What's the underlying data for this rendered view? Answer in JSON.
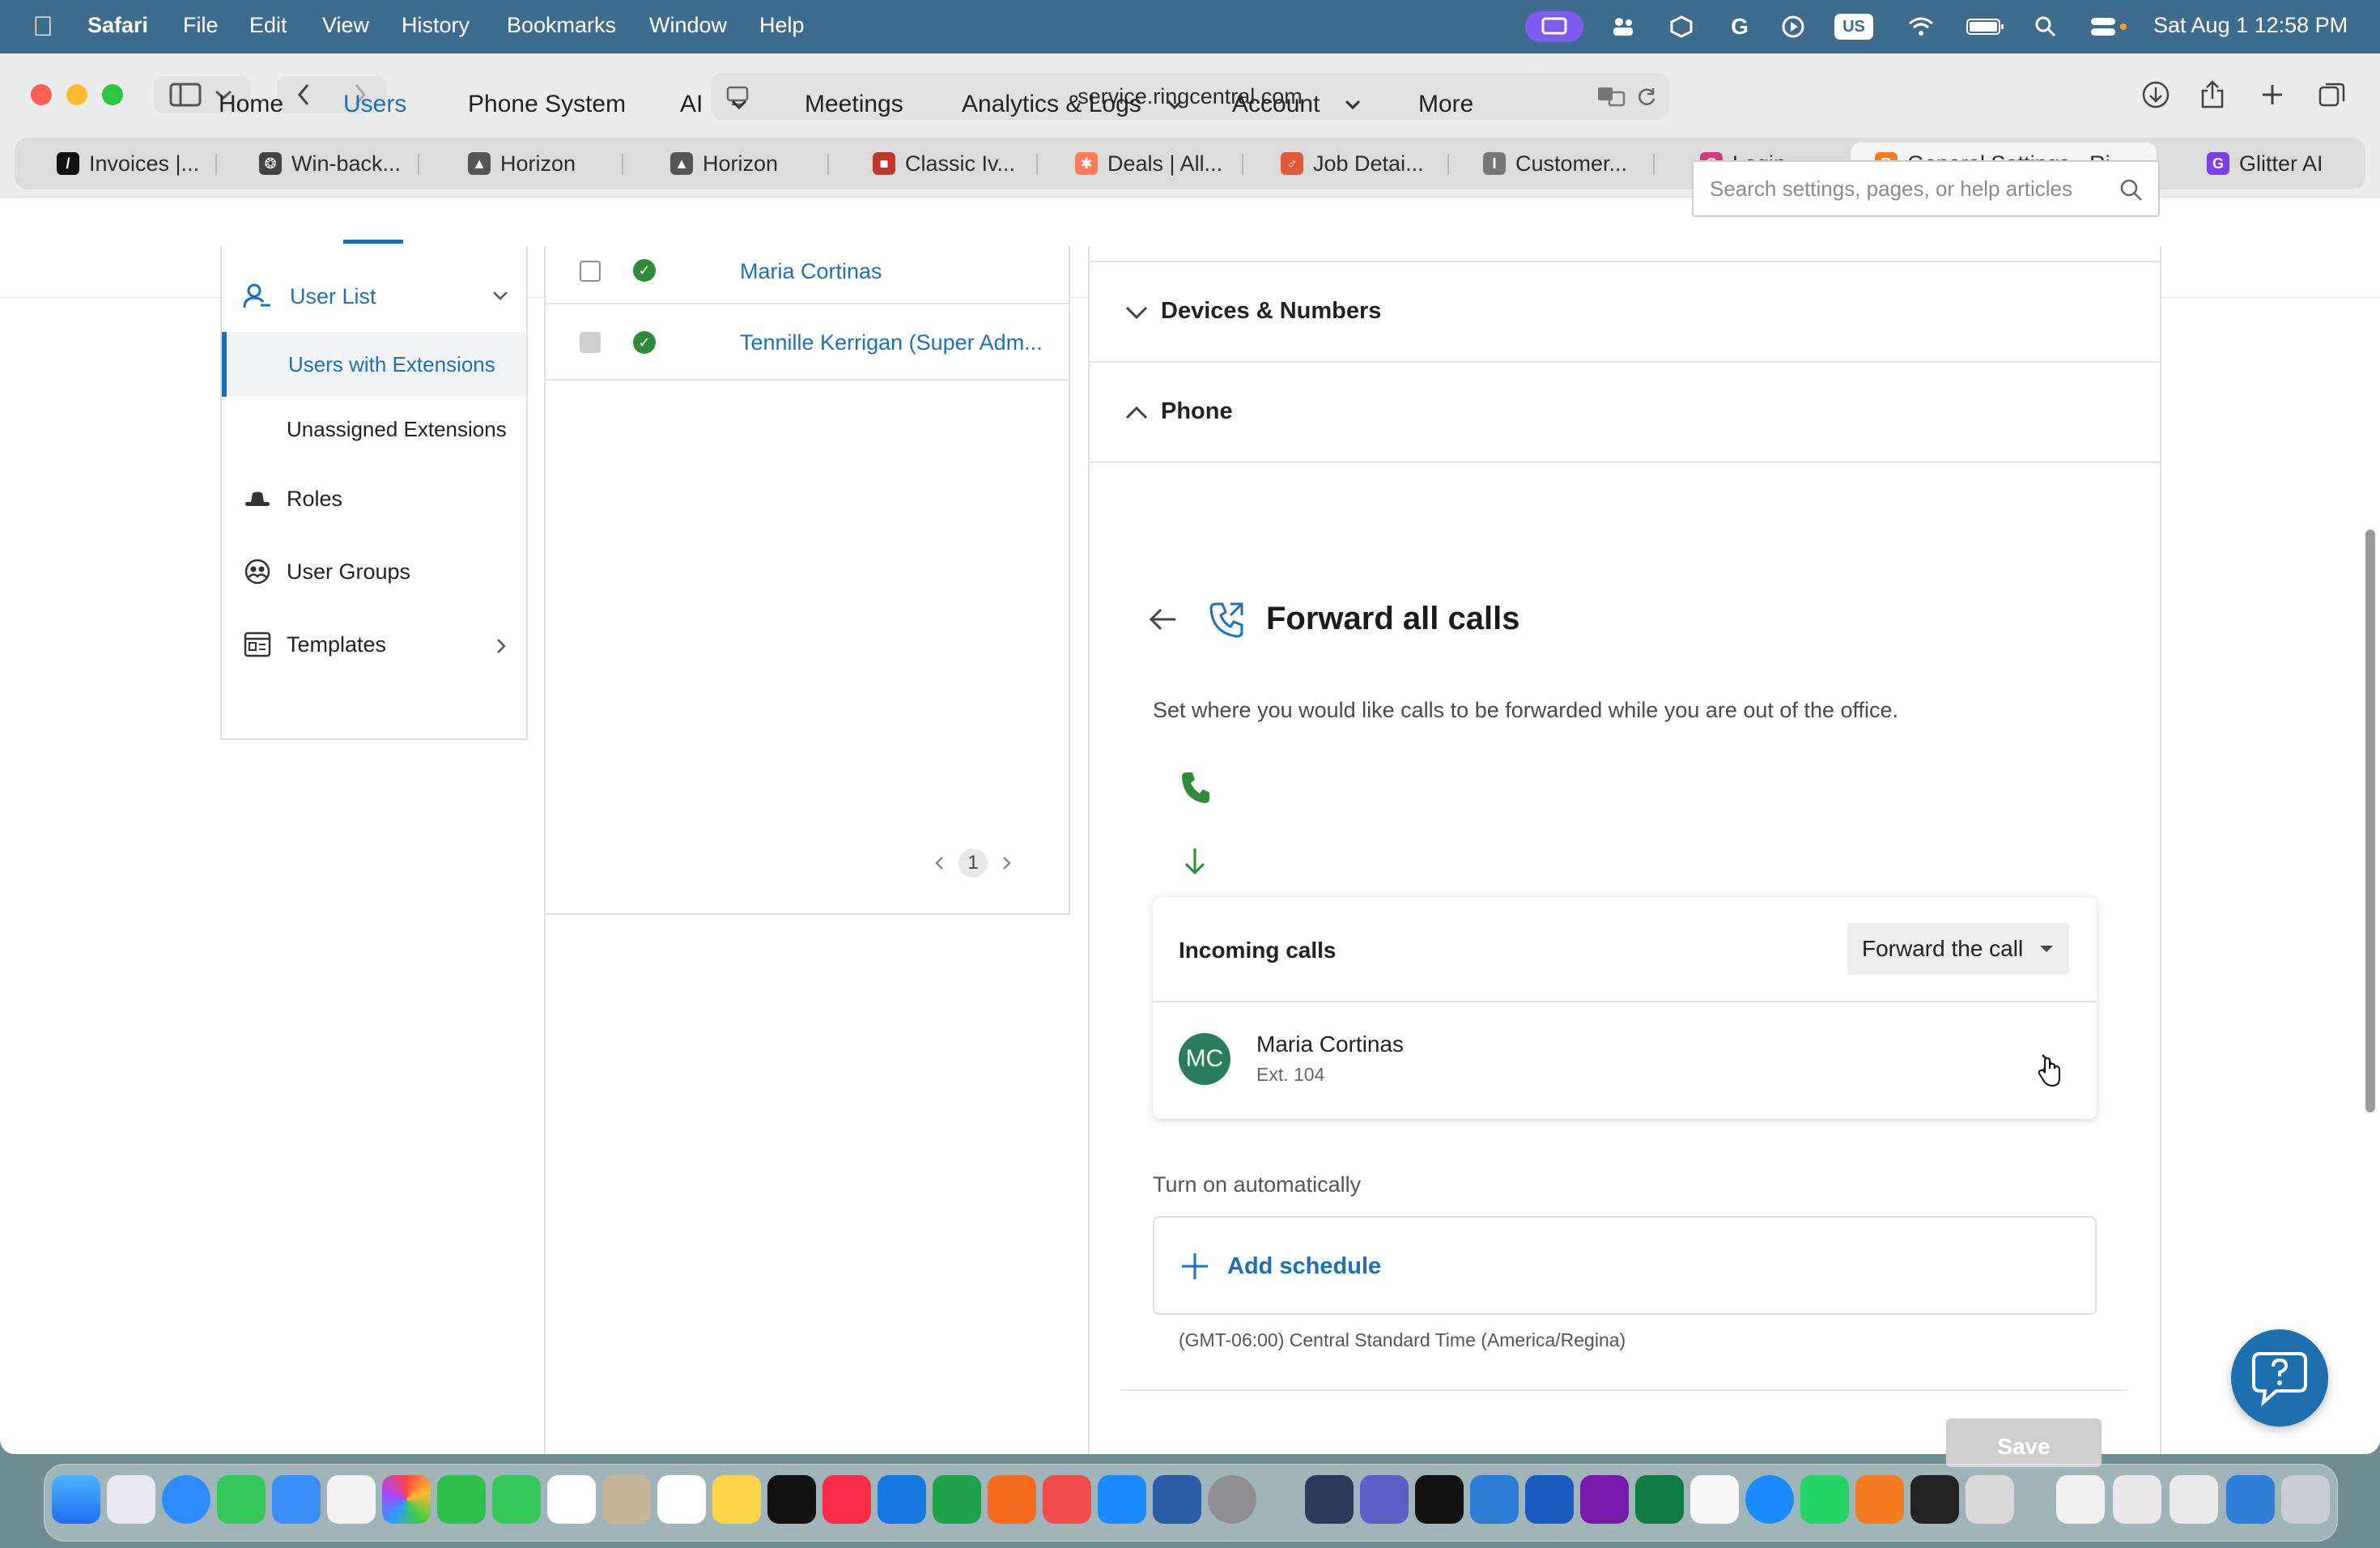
{
  "menubar": {
    "app": "Safari",
    "items": [
      "File",
      "Edit",
      "View",
      "History",
      "Bookmarks",
      "Window",
      "Help"
    ],
    "input_badge": "US",
    "clock": "Sat Aug 1  12:58 PM"
  },
  "browser": {
    "url": "service.ringcentral.com",
    "tabs": [
      {
        "label": "Invoices |...",
        "color": "#111111",
        "letter": "/"
      },
      {
        "label": "Win-back...",
        "color": "#444444",
        "letter": "❂"
      },
      {
        "label": "Horizon",
        "color": "#555555",
        "letter": "▲"
      },
      {
        "label": "Horizon",
        "color": "#555555",
        "letter": "▲"
      },
      {
        "label": "Classic Iv...",
        "color": "#c0392b",
        "letter": "■"
      },
      {
        "label": "Deals | All...",
        "color": "#ff7a59",
        "letter": "✱"
      },
      {
        "label": "Job Detai...",
        "color": "#e05a3a",
        "letter": "♂"
      },
      {
        "label": "Customer...",
        "color": "#777777",
        "letter": "I"
      },
      {
        "label": "Login",
        "color": "#d63a7a",
        "letter": "C"
      },
      {
        "label": "General Settings - Ri...",
        "color": "#f47b20",
        "letter": "R"
      },
      {
        "label": "Glitter AI",
        "color": "#7b3fe4",
        "letter": "G"
      }
    ]
  },
  "appnav": {
    "items": [
      {
        "label": "Home",
        "dropdown": false
      },
      {
        "label": "Users",
        "dropdown": false
      },
      {
        "label": "Phone System",
        "dropdown": false
      },
      {
        "label": "AI",
        "dropdown": true
      },
      {
        "label": "Meetings",
        "dropdown": false
      },
      {
        "label": "Analytics & Logs",
        "dropdown": true
      },
      {
        "label": "Account",
        "dropdown": true
      },
      {
        "label": "More",
        "dropdown": false
      }
    ],
    "search_placeholder": "Search settings, pages, or help articles"
  },
  "sidebar": {
    "user_list": "User List",
    "users_with_extensions": "Users with Extensions",
    "unassigned_extensions": "Unassigned Extensions",
    "roles": "Roles",
    "user_groups": "User Groups",
    "templates": "Templates"
  },
  "users": {
    "rows": [
      {
        "name": "Maria Cortinas",
        "checkbox_disabled": false
      },
      {
        "name": "Tennille Kerrigan (Super Adm...",
        "checkbox_disabled": true
      }
    ],
    "page": "1"
  },
  "detail": {
    "devices_numbers": "Devices & Numbers",
    "phone": "Phone",
    "forward_title": "Forward all calls",
    "forward_desc": "Set where you would like calls to be forwarded while you are out of the office.",
    "incoming_calls": "Incoming calls",
    "dropdown_value": "Forward the call",
    "target_initials": "MC",
    "target_name": "Maria Cortinas",
    "target_ext": "Ext. 104",
    "turn_on_auto": "Turn on automatically",
    "add_schedule": "Add schedule",
    "timezone": "(GMT-06:00) Central Standard Time (America/Regina)",
    "save": "Save"
  },
  "colors": {
    "accent": "#1f6fb5",
    "success": "#2e8b3a",
    "avatar": "#2a7d5f",
    "menubar": "#3d6c8f"
  }
}
